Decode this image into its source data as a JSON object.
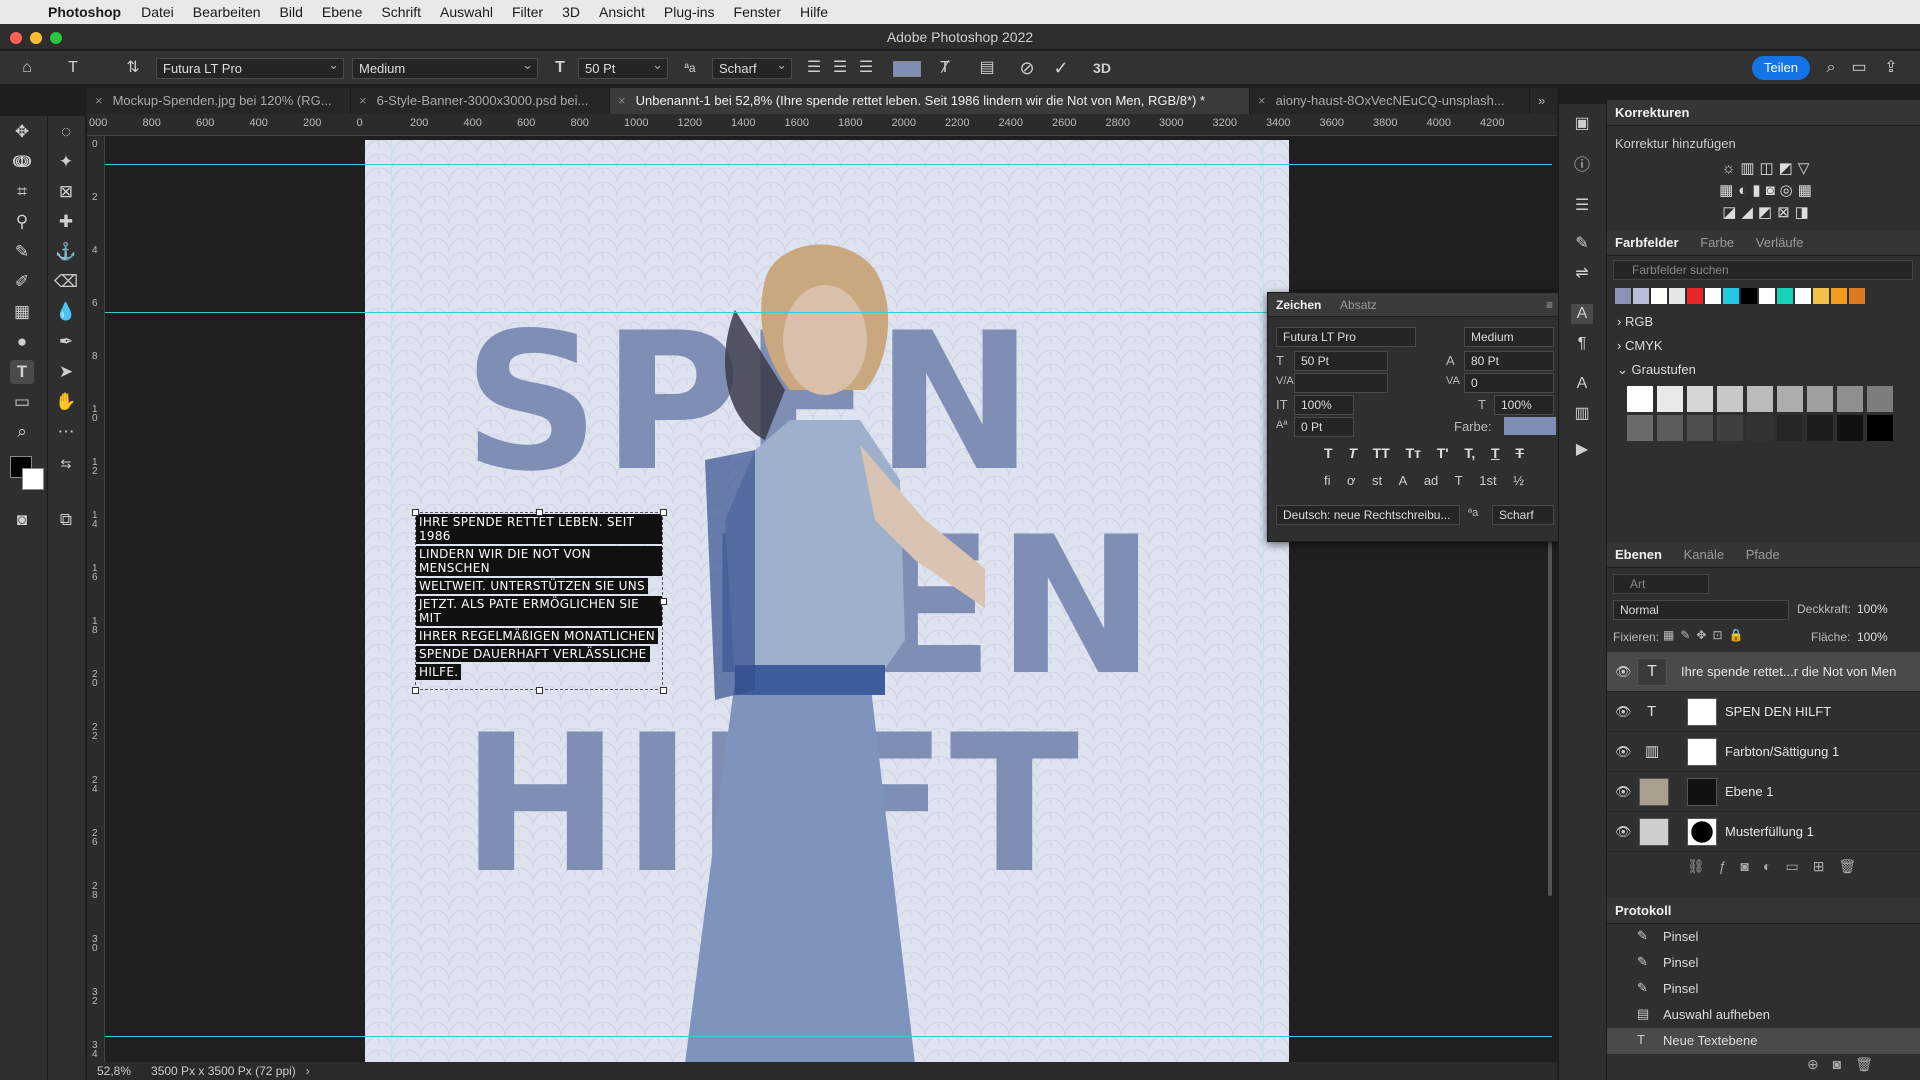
{
  "menubar": {
    "app": "Photoshop",
    "items": [
      "Datei",
      "Bearbeiten",
      "Bild",
      "Ebene",
      "Schrift",
      "Auswahl",
      "Filter",
      "3D",
      "Ansicht",
      "Plug-ins",
      "Fenster",
      "Hilfe"
    ]
  },
  "window": {
    "title": "Adobe Photoshop 2022"
  },
  "options": {
    "font_family": "Futura LT Pro",
    "font_style": "Medium",
    "font_size": "50 Pt",
    "aa_label": "ªa",
    "antialias": "Scharf",
    "share_label": "Teilen",
    "three_d": "3D"
  },
  "tabs": [
    {
      "label": "Mockup-Spenden.jpg bei 120% (RG..."
    },
    {
      "label": "6-Style-Banner-3000x3000.psd bei..."
    },
    {
      "label": "Unbenannt-1 bei 52,8% (Ihre spende rettet leben. Seit 1986 lindern wir die Not von Men, RGB/8*) *"
    },
    {
      "label": "aiony-haust-8OxVecNEuCQ-unsplash..."
    }
  ],
  "ruler": {
    "top": [
      "000",
      "800",
      "600",
      "400",
      "200",
      "0",
      "200",
      "400",
      "600",
      "800",
      "1000",
      "1200",
      "1400",
      "1600",
      "1800",
      "2000",
      "2200",
      "2400",
      "2600",
      "2800",
      "3000",
      "3200",
      "3400",
      "3600",
      "3800",
      "4000",
      "4200"
    ],
    "left": [
      "0",
      "2",
      "4",
      "6",
      "8",
      "1 0",
      "1 2",
      "1 4",
      "1 6",
      "1 8",
      "2 0",
      "2 2",
      "2 4",
      "2 6",
      "2 8",
      "3 0",
      "3 2",
      "3 4"
    ]
  },
  "document": {
    "word1": "SPEN",
    "word2": "DEN",
    "word3": "HILFT",
    "body_lines": [
      "IHRE SPENDE RETTET LEBEN. SEIT 1986",
      "LINDERN WIR DIE NOT VON MENSCHEN",
      "WELTWEIT. UNTERSTÜTZEN SIE UNS",
      "JETZT. ALS PATE ERMÖGLICHEN SIE MIT",
      "IHRER REGELMÄßIGEN MONATLICHEN",
      "SPENDE DAUERHAFT VERLÄSSLICHE",
      "HILFE."
    ],
    "text_color": "#7e8eb4"
  },
  "character_panel": {
    "tabs": [
      "Zeichen",
      "Absatz"
    ],
    "font_family": "Futura LT Pro",
    "font_style": "Medium",
    "size": "50 Pt",
    "leading": "80 Pt",
    "tracking": "0",
    "vscale": "100%",
    "hscale": "100%",
    "baseline": "0 Pt",
    "color_label": "Farbe:",
    "language": "Deutsch: neue Rechtschreibu...",
    "aa_label": "ªa",
    "antialias": "Scharf",
    "style_buttons": [
      "T",
      "T",
      "TT",
      "Tт",
      "T'",
      "T,",
      "T",
      "T"
    ],
    "opentype_buttons": [
      "fi",
      "ơ",
      "st",
      "A",
      "ad",
      "T",
      "1st",
      "½"
    ]
  },
  "korrekturen": {
    "title": "Korrekturen",
    "subtitle": "Korrektur hinzufügen"
  },
  "farbfelder": {
    "tabs": [
      "Farbfelder",
      "Farbe",
      "Verläufe"
    ],
    "search_placeholder": "Farbfelder suchen",
    "swatches": [
      "#8a92b8",
      "#b8bed6",
      "#ffffff",
      "#e6e6e6",
      "#e8262b",
      "#ffffff",
      "#26c7e2",
      "#000000",
      "#ffffff",
      "#19d1b7",
      "#ffffff",
      "#f0c24b",
      "#f39a1e",
      "#d97b1e"
    ],
    "groups": [
      "RGB",
      "CMYK",
      "Graustufen"
    ],
    "grays": [
      "#ffffff",
      "#e8e8e8",
      "#d6d6d6",
      "#c8c8c8",
      "#bbbbbb",
      "#adadad",
      "#a0a0a0",
      "#8f8f8f",
      "#7d7d7d",
      "#6b6b6b",
      "#5c5c5c",
      "#4e4e4e",
      "#404040",
      "#333333",
      "#262626",
      "#1c1c1c",
      "#111111",
      "#000000"
    ]
  },
  "layers": {
    "tabs": [
      "Ebenen",
      "Kanäle",
      "Pfade"
    ],
    "filter_placeholder": "Art",
    "blend_mode": "Normal",
    "opacity_label": "Deckkraft:",
    "opacity": "100%",
    "lock_label": "Fixieren:",
    "fill_label": "Fläche:",
    "fill": "100%",
    "items": [
      {
        "name": "Ihre spende rettet...r die Not von Men"
      },
      {
        "name": "SPEN    DEN HILFT"
      },
      {
        "name": "Farbton/Sättigung 1"
      },
      {
        "name": "Ebene 1"
      },
      {
        "name": "Musterfüllung 1"
      }
    ]
  },
  "history": {
    "title": "Protokoll",
    "items": [
      "Pinsel",
      "Pinsel",
      "Pinsel",
      "Auswahl aufheben",
      "Neue Textebene"
    ]
  },
  "status": {
    "zoom": "52,8%",
    "info": "3500 Px x 3500 Px (72 ppi)"
  }
}
